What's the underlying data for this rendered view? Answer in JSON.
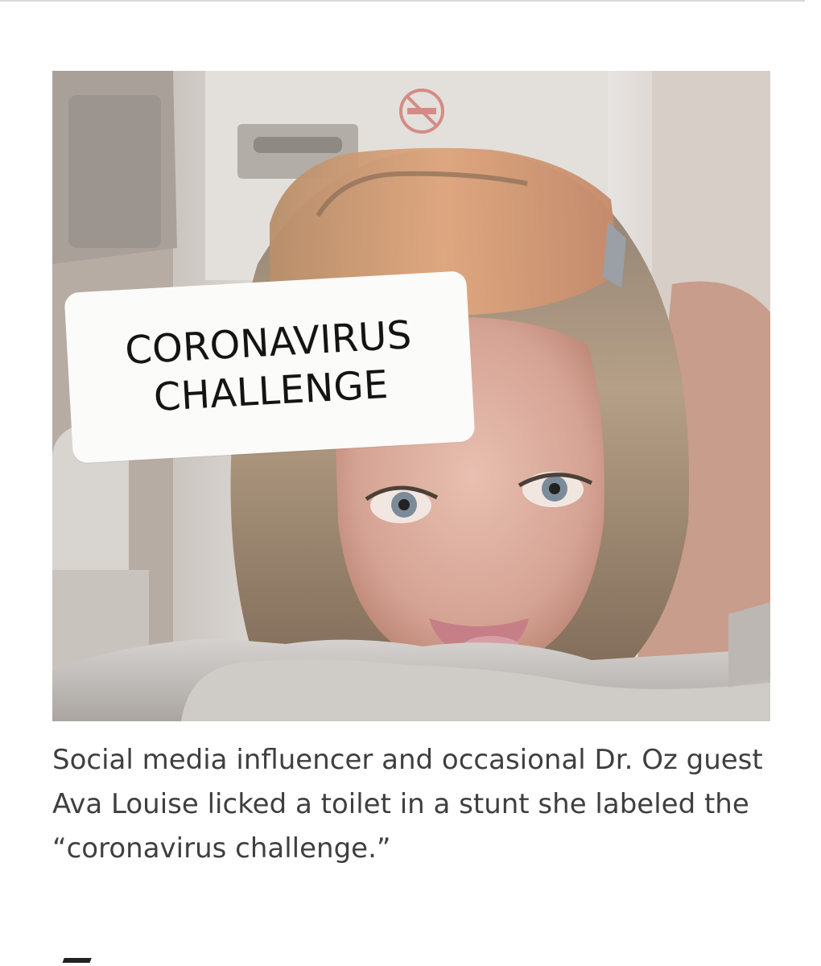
{
  "image": {
    "sticker_text": "CORONAVIRUS\nCHALLENGE",
    "no_smoking_icon": "no-smoking-icon"
  },
  "caption": "Social media influencer and occasional Dr. Oz guest Ava Louise licked a toilet in a stunt she labeled the “coronavirus challenge.”",
  "next_heading": ""
}
